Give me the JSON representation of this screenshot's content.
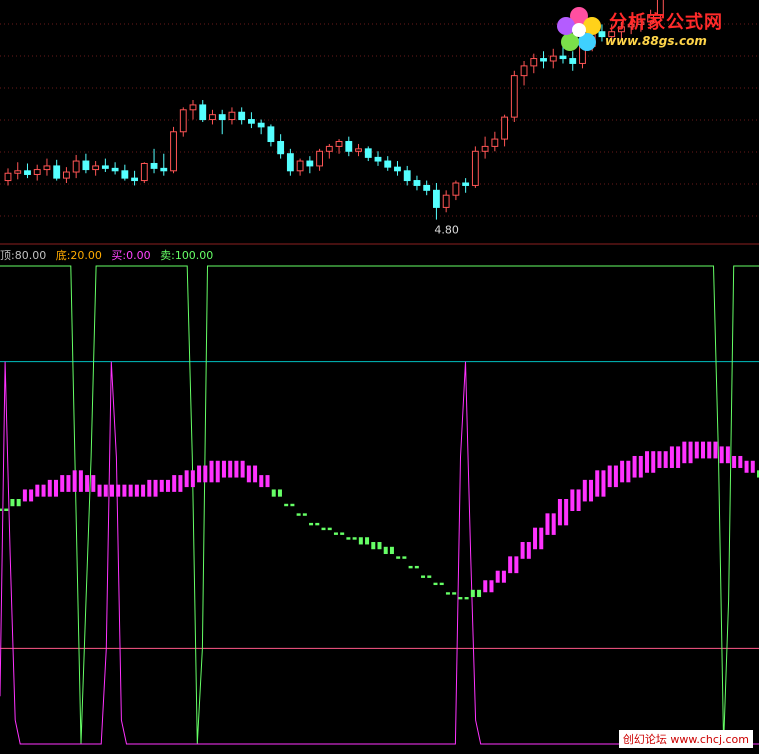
{
  "legend": {
    "top_label": "顶:80.00",
    "bottom_label": "底:20.00",
    "buy_label": "买:0.00",
    "sell_label": "卖:100.00"
  },
  "annotation": {
    "low_price": "4.80"
  },
  "watermark": {
    "site_name": "分析家公式网",
    "site_url": "www.88gs.com",
    "footer": "创幻论坛 www.chcj.com"
  },
  "colors": {
    "background": "#000000",
    "candle_up": "#ff5555",
    "candle_down": "#55ffff",
    "separator": "#8b2020",
    "level_top": "#00c0c0",
    "level_bottom": "#ff5a8a",
    "line_green": "#66ff66",
    "line_magenta": "#ff33ff",
    "legend_top": "#c0c0c0",
    "legend_bottom": "#ffaa00",
    "legend_buy": "#ff44ff",
    "legend_sell": "#66ff66"
  },
  "chart_data": [
    {
      "type": "candlestick",
      "price_min": 4.6,
      "price_max": 6.6,
      "ohlc": [
        [
          5.12,
          5.22,
          5.08,
          5.18
        ],
        [
          5.18,
          5.27,
          5.13,
          5.2
        ],
        [
          5.2,
          5.26,
          5.14,
          5.17
        ],
        [
          5.17,
          5.25,
          5.12,
          5.21
        ],
        [
          5.21,
          5.3,
          5.16,
          5.24
        ],
        [
          5.24,
          5.29,
          5.12,
          5.14
        ],
        [
          5.14,
          5.23,
          5.1,
          5.19
        ],
        [
          5.19,
          5.33,
          5.14,
          5.28
        ],
        [
          5.28,
          5.34,
          5.18,
          5.21
        ],
        [
          5.21,
          5.28,
          5.16,
          5.24
        ],
        [
          5.24,
          5.3,
          5.19,
          5.22
        ],
        [
          5.22,
          5.27,
          5.17,
          5.2
        ],
        [
          5.2,
          5.25,
          5.12,
          5.14
        ],
        [
          5.14,
          5.2,
          5.08,
          5.12
        ],
        [
          5.12,
          5.27,
          5.1,
          5.26
        ],
        [
          5.26,
          5.38,
          5.18,
          5.22
        ],
        [
          5.22,
          5.34,
          5.16,
          5.2
        ],
        [
          5.2,
          5.56,
          5.18,
          5.52
        ],
        [
          5.52,
          5.72,
          5.48,
          5.7
        ],
        [
          5.7,
          5.78,
          5.62,
          5.74
        ],
        [
          5.74,
          5.78,
          5.6,
          5.62
        ],
        [
          5.62,
          5.7,
          5.58,
          5.66
        ],
        [
          5.66,
          5.7,
          5.5,
          5.62
        ],
        [
          5.62,
          5.72,
          5.58,
          5.68
        ],
        [
          5.68,
          5.72,
          5.58,
          5.62
        ],
        [
          5.62,
          5.68,
          5.55,
          5.59
        ],
        [
          5.59,
          5.62,
          5.5,
          5.56
        ],
        [
          5.56,
          5.58,
          5.4,
          5.44
        ],
        [
          5.44,
          5.5,
          5.3,
          5.34
        ],
        [
          5.34,
          5.38,
          5.16,
          5.2
        ],
        [
          5.2,
          5.3,
          5.16,
          5.28
        ],
        [
          5.28,
          5.32,
          5.18,
          5.24
        ],
        [
          5.24,
          5.38,
          5.2,
          5.36
        ],
        [
          5.36,
          5.42,
          5.3,
          5.4
        ],
        [
          5.4,
          5.46,
          5.34,
          5.44
        ],
        [
          5.44,
          5.48,
          5.32,
          5.36
        ],
        [
          5.36,
          5.42,
          5.32,
          5.38
        ],
        [
          5.38,
          5.4,
          5.28,
          5.31
        ],
        [
          5.31,
          5.36,
          5.24,
          5.28
        ],
        [
          5.28,
          5.32,
          5.2,
          5.23
        ],
        [
          5.23,
          5.28,
          5.16,
          5.2
        ],
        [
          5.2,
          5.24,
          5.08,
          5.12
        ],
        [
          5.12,
          5.16,
          5.04,
          5.08
        ],
        [
          5.08,
          5.12,
          5.0,
          5.04
        ],
        [
          5.04,
          5.1,
          4.8,
          4.9
        ],
        [
          4.9,
          5.04,
          4.86,
          5.0
        ],
        [
          5.0,
          5.12,
          4.96,
          5.1
        ],
        [
          5.1,
          5.14,
          5.02,
          5.08
        ],
        [
          5.08,
          5.4,
          5.06,
          5.36
        ],
        [
          5.36,
          5.48,
          5.3,
          5.4
        ],
        [
          5.4,
          5.52,
          5.36,
          5.46
        ],
        [
          5.46,
          5.66,
          5.4,
          5.64
        ],
        [
          5.64,
          6.02,
          5.6,
          5.98
        ],
        [
          5.98,
          6.1,
          5.9,
          6.06
        ],
        [
          6.06,
          6.16,
          6.0,
          6.12
        ],
        [
          6.12,
          6.18,
          6.04,
          6.1
        ],
        [
          6.1,
          6.2,
          6.04,
          6.14
        ],
        [
          6.14,
          6.22,
          6.08,
          6.12
        ],
        [
          6.12,
          6.18,
          6.02,
          6.08
        ],
        [
          6.08,
          6.24,
          6.04,
          6.22
        ],
        [
          6.22,
          6.38,
          6.18,
          6.34
        ],
        [
          6.34,
          6.4,
          6.26,
          6.3
        ],
        [
          6.3,
          6.4,
          6.24,
          6.34
        ],
        [
          6.34,
          6.42,
          6.28,
          6.38
        ],
        [
          6.38,
          6.46,
          6.32,
          6.4
        ],
        [
          6.4,
          6.48,
          6.34,
          6.42
        ],
        [
          6.42,
          6.52,
          6.36,
          6.48
        ],
        [
          6.48,
          6.68,
          6.44,
          6.64
        ],
        [
          6.64,
          6.8,
          6.6,
          6.76
        ],
        [
          6.76,
          6.84,
          6.7,
          6.8
        ],
        [
          6.8,
          6.86,
          6.74,
          6.82
        ],
        [
          6.82,
          6.9,
          6.76,
          6.84
        ],
        [
          6.84,
          6.86,
          6.66,
          6.7
        ],
        [
          6.7,
          6.8,
          6.66,
          6.78
        ],
        [
          6.78,
          6.86,
          6.74,
          6.82
        ],
        [
          6.82,
          6.9,
          6.78,
          6.86
        ]
      ],
      "low_marker_index": 44
    },
    {
      "type": "line",
      "ylim": [
        0,
        100
      ],
      "levels": {
        "top": 80,
        "bottom": 20
      },
      "series": [
        {
          "name": "卖",
          "values": [
            100,
            100,
            100,
            100,
            100,
            100,
            100,
            100,
            100,
            100,
            100,
            100,
            100,
            100,
            100,
            50,
            0,
            30,
            60,
            100,
            100,
            100,
            100,
            100,
            100,
            100,
            100,
            100,
            100,
            100,
            100,
            100,
            100,
            100,
            100,
            100,
            100,
            100,
            60,
            0,
            20,
            100,
            100,
            100,
            100,
            100,
            100,
            100,
            100,
            100,
            100,
            100,
            100,
            100,
            100,
            100,
            100,
            100,
            100,
            100,
            100,
            100,
            100,
            100,
            100,
            100,
            100,
            100,
            100,
            100,
            100,
            100,
            100,
            100,
            100,
            100,
            100,
            100,
            100,
            100,
            100,
            100,
            100,
            100,
            100,
            100,
            100,
            100,
            100,
            100,
            100,
            100,
            100,
            100,
            100,
            100,
            100,
            100,
            100,
            100,
            100,
            100,
            100,
            100,
            100,
            100,
            100,
            100,
            100,
            100,
            100,
            100,
            100,
            100,
            100,
            100,
            100,
            100,
            100,
            100,
            100,
            100,
            100,
            100,
            100,
            100,
            100,
            100,
            100,
            100,
            100,
            100,
            100,
            100,
            100,
            100,
            100,
            100,
            100,
            100,
            100,
            100,
            60,
            0,
            30,
            100,
            100,
            100,
            100,
            100,
            100
          ]
        },
        {
          "name": "买",
          "values": [
            10,
            80,
            40,
            5,
            0,
            0,
            0,
            0,
            0,
            0,
            0,
            0,
            0,
            0,
            0,
            0,
            0,
            0,
            0,
            0,
            0,
            20,
            80,
            60,
            5,
            0,
            0,
            0,
            0,
            0,
            0,
            0,
            0,
            0,
            0,
            0,
            0,
            0,
            0,
            0,
            0,
            0,
            0,
            0,
            0,
            0,
            0,
            0,
            0,
            0,
            0,
            0,
            0,
            0,
            0,
            0,
            0,
            0,
            0,
            0,
            0,
            0,
            0,
            0,
            0,
            0,
            0,
            0,
            0,
            0,
            0,
            0,
            0,
            0,
            0,
            0,
            0,
            0,
            0,
            0,
            0,
            0,
            0,
            0,
            0,
            0,
            0,
            0,
            0,
            0,
            0,
            60,
            80,
            40,
            5,
            0,
            0,
            0,
            0,
            0,
            0,
            0,
            0,
            0,
            0,
            0,
            0,
            0,
            0,
            0,
            0,
            0,
            0,
            0,
            0,
            0,
            0,
            0,
            0,
            0,
            0,
            0,
            0,
            0,
            0,
            0,
            0,
            0,
            0,
            0,
            0,
            0,
            0,
            0,
            0,
            0,
            0,
            0,
            0,
            0,
            0,
            0,
            0,
            0,
            0,
            0,
            0,
            0,
            0,
            0,
            0
          ]
        },
        {
          "name": "osc",
          "values": [
            48,
            50,
            52,
            53,
            54,
            55,
            56,
            55,
            53,
            53,
            53,
            53,
            54,
            54,
            55,
            56,
            57,
            58,
            58,
            58,
            57,
            55,
            52,
            49,
            47,
            45,
            44,
            43,
            42,
            42,
            41,
            40,
            38,
            36,
            34,
            32,
            30,
            29,
            31,
            33,
            35,
            38,
            41,
            44,
            47,
            50,
            52,
            54,
            56,
            57,
            58,
            59,
            60,
            60,
            61,
            62,
            62,
            62,
            61,
            59,
            58,
            56
          ]
        },
        {
          "name": "sig",
          "values": [
            50,
            51,
            52,
            53,
            53,
            54,
            54,
            54,
            53,
            53,
            53,
            53,
            53,
            54,
            54,
            55,
            56,
            56,
            57,
            57,
            56,
            55,
            53,
            51,
            49,
            47,
            46,
            45,
            44,
            43,
            42,
            41,
            40,
            38,
            36,
            35,
            33,
            32,
            32,
            33,
            35,
            37,
            40,
            42,
            45,
            47,
            50,
            52,
            53,
            55,
            56,
            57,
            58,
            59,
            59,
            60,
            61,
            61,
            60,
            59,
            58,
            57
          ]
        }
      ]
    }
  ]
}
